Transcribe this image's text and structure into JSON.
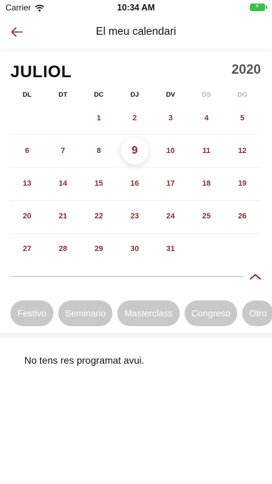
{
  "status_bar": {
    "carrier": "Carrier",
    "time": "10:34 AM"
  },
  "nav": {
    "title": "El meu calendari",
    "back_icon": "arrow-left-icon",
    "accent_color": "#8b2a2a"
  },
  "calendar": {
    "month": "JULIOL",
    "year": "2020",
    "weekdays": [
      {
        "label": "DL",
        "dim": false
      },
      {
        "label": "DT",
        "dim": false
      },
      {
        "label": "DC",
        "dim": false
      },
      {
        "label": "DJ",
        "dim": false
      },
      {
        "label": "DV",
        "dim": false
      },
      {
        "label": "DS",
        "dim": true
      },
      {
        "label": "DG",
        "dim": true
      }
    ],
    "weeks": [
      [
        "",
        "",
        "1",
        "2",
        "3",
        "4",
        "5"
      ],
      [
        "6",
        "7",
        "8",
        "9",
        "10",
        "11",
        "12"
      ],
      [
        "13",
        "14",
        "15",
        "16",
        "17",
        "18",
        "19"
      ],
      [
        "20",
        "21",
        "22",
        "23",
        "24",
        "25",
        "26"
      ],
      [
        "27",
        "28",
        "29",
        "30",
        "31",
        "",
        ""
      ]
    ],
    "today": "9",
    "collapse_icon": "chevron-up-icon"
  },
  "filters": [
    "Festivo",
    "Seminario",
    "Masterclass",
    "Congreso",
    "Otro"
  ],
  "empty_message": "No tens res programat avui."
}
